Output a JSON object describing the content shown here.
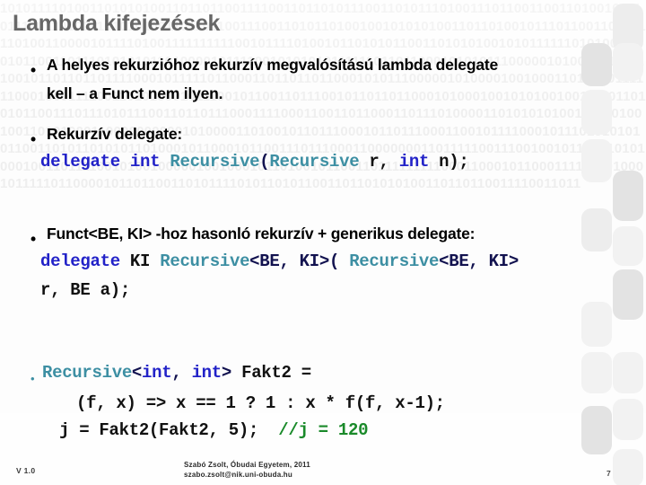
{
  "slide": {
    "title": "Lambda kifejezések",
    "page_number": "7",
    "title_color": "#676767",
    "background_pattern": "binary-digits",
    "background_text": "1010111101001101010100110110110011110011011010111001101011101001110110011001101001011101110011010011010101001101101100111001101011010010010101010011011010010111011001101011110100110000101111010011111111110010111101001011010101100110101010010101111110101001100101100110111010101011010000101111001010101011111101101100010101011100000101000011101110010110110110111100010111110110001101101101100010101110000010100001001000110101001111110001000111100110101000101110010110011011100101101101100010100010010101001001111011010101100111011101011100110110111000111100011001101100011011101000011010101010011011010010011010100011000000000010100001101001011011100010110111000110010111100010111010101010110011010110101011010001011000101100111011100011000000011011111001110010010110101010100010011011110010100100000100100010110100101100110111111111000110001011000111101101000101111101100001011011001101011110101101011001101101010100110110110011110011011"
  },
  "bullets": [
    {
      "marker": "•",
      "lines": [
        {
          "type": "text",
          "content": "A helyes rekurzióhoz rekurzív megvalósítású lambda delegate"
        },
        {
          "type": "text",
          "content": "kell –  a Funct nem ilyen."
        }
      ]
    },
    {
      "marker": "•",
      "lines": [
        {
          "type": "text",
          "content": "Rekurzív delegate:"
        }
      ]
    },
    {
      "marker": "•",
      "lines": [
        {
          "type": "text",
          "content": "Funct<BE, KI> -hoz hasonló rekurzív + generikus delegate:"
        }
      ]
    },
    {
      "marker": "•",
      "lines": [
        {
          "type": "code",
          "content": "Recursive<int, int> Fakt2 ="
        }
      ]
    }
  ],
  "code_blocks": {
    "recursive_delegate": {
      "tokens": [
        {
          "text": "delegate",
          "color": "#2222c8"
        },
        {
          "text": " ",
          "color": "#111111"
        },
        {
          "text": "int",
          "color": "#2222c8"
        },
        {
          "text": " ",
          "color": "#111111"
        },
        {
          "text": "Recursive",
          "color": "#3d8fa3"
        },
        {
          "text": "(",
          "color": "#12124f"
        },
        {
          "text": "Recursive",
          "color": "#3d8fa3"
        },
        {
          "text": " r, ",
          "color": "#111111"
        },
        {
          "text": "int",
          "color": "#2222c8"
        },
        {
          "text": " n);",
          "color": "#111111"
        }
      ],
      "plain": "delegate int Recursive(Recursive r, int n);"
    },
    "generic_delegate_line1": {
      "tokens": [
        {
          "text": "delegate",
          "color": "#2222c8"
        },
        {
          "text": " KI ",
          "color": "#111111"
        },
        {
          "text": "Recursive",
          "color": "#3d8fa3"
        },
        {
          "text": "<BE, KI>(",
          "color": "#12124f"
        },
        {
          "text": " ",
          "color": "#111111"
        },
        {
          "text": "Recursive",
          "color": "#3d8fa3"
        },
        {
          "text": "<BE, KI>",
          "color": "#12124f"
        }
      ],
      "plain": "delegate KI Recursive<BE, KI>( Recursive<BE, KI>"
    },
    "generic_delegate_line2": {
      "plain": "r, BE a);"
    },
    "fakt2_header": {
      "tokens": [
        {
          "text": "Recursive",
          "color": "#3d8fa3"
        },
        {
          "text": "<",
          "color": "#12124f"
        },
        {
          "text": "int",
          "color": "#2222c8"
        },
        {
          "text": ", ",
          "color": "#12124f"
        },
        {
          "text": "int",
          "color": "#2222c8"
        },
        {
          "text": ">",
          "color": "#12124f"
        },
        {
          "text": " Fakt2 =",
          "color": "#111111"
        }
      ],
      "plain": "Recursive<int, int> Fakt2 ="
    },
    "fakt2_body": {
      "plain": "(f, x) => x == 1 ? 1 : x * f(f, x-1);"
    },
    "fakt2_call": {
      "code": "j = Fakt2(Fakt2, 5);",
      "comment": "//j = 120",
      "comment_color": "#1a8a2a"
    }
  },
  "footer": {
    "version": "V 1.0",
    "author_line": "Szabó Zsolt, Óbudai Egyetem, 2011",
    "email_line": "szabo.zsolt@nik.uni-obuda.hu"
  }
}
